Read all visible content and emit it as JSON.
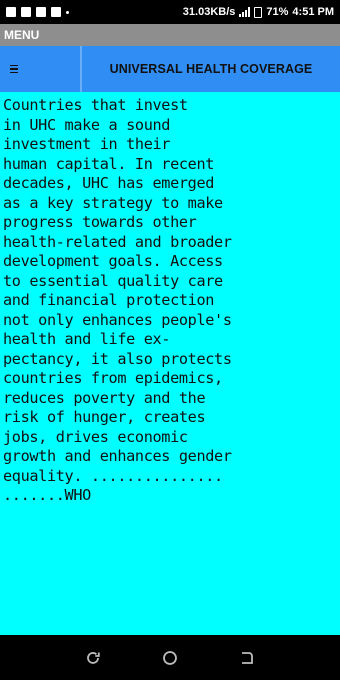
{
  "status_bar": {
    "speed": "31.03KB/s",
    "battery": "71%",
    "time": "4:51 PM"
  },
  "app_bar": {
    "title": "MENU"
  },
  "header": {
    "menu_glyph": "≡",
    "title": "UNIVERSAL HEALTH COVERAGE"
  },
  "content": {
    "text": "Countries that invest\nin UHC make a sound\ninvestment in their\nhuman capital. In recent\ndecades, UHC has emerged\nas a key strategy to make\nprogress towards other\nhealth-related and broader\ndevelopment goals. Access\nto essential quality care\nand financial protection\nnot only enhances people's\nhealth and life ex-\npectancy, it also protects\ncountries from epidemics,\nreduces poverty and the\nrisk of hunger, creates\njobs, drives economic\ngrowth and enhances gender\nequality. ...............\n.......WHO"
  },
  "nav_bar": {
    "icons": [
      "recent-apps-icon",
      "home-icon",
      "back-icon"
    ]
  }
}
